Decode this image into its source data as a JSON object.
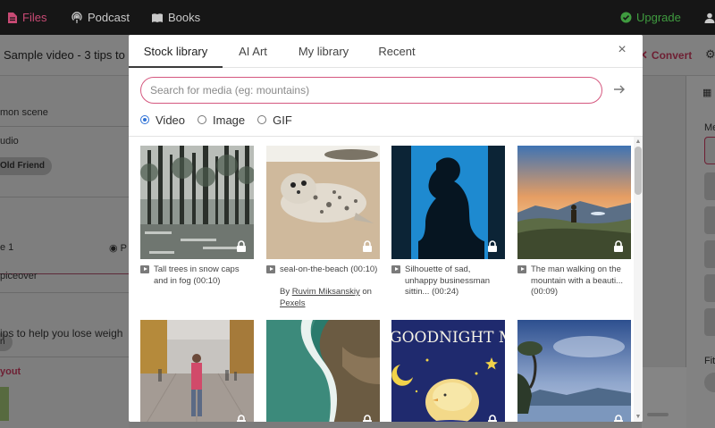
{
  "topnav": {
    "files": "Files",
    "podcast": "Podcast",
    "books": "Books",
    "upgrade": "Upgrade"
  },
  "editor": {
    "title": "Sample video - 3 tips to",
    "convert": "Convert",
    "left_rows": {
      "row1": "mon scene",
      "row2": "udio",
      "chip": "Old Friend",
      "scene": "e 1",
      "scene_right": "P",
      "voiceover": "piceover",
      "chip2": "n",
      "script": "ips to help you lose weigh",
      "layout": "yout"
    },
    "right_rows": {
      "me": "Me",
      "fit": "Fit"
    }
  },
  "modal": {
    "tabs": [
      "Stock library",
      "AI Art",
      "My library",
      "Recent"
    ],
    "active_tab": "Stock library",
    "close_icon": "close-icon",
    "search": {
      "placeholder": "Search for media (eg: mountains)",
      "value": ""
    },
    "media_types": [
      "Video",
      "Image",
      "GIF"
    ],
    "selected_media_type": "Video",
    "results": [
      {
        "caption": "Tall trees in snow caps and in fog (00:10)",
        "locked": true
      },
      {
        "caption": "seal-on-the-beach (00:10)",
        "credit_prefix": "By",
        "credit_author": "Ruvim Miksanskiy",
        "credit_mid": "on",
        "credit_source": "Pexels",
        "locked": true
      },
      {
        "caption": "Silhouette of sad, unhappy businessman sittin... (00:24)",
        "locked": true
      },
      {
        "caption": "The man walking on the mountain with a beauti... (00:09)",
        "locked": true
      },
      {
        "caption": "",
        "locked": true
      },
      {
        "caption": "",
        "locked": true
      },
      {
        "caption": "",
        "overlay_text": "GOODNIGHT MY LOV",
        "locked": true
      },
      {
        "caption": "",
        "locked": true
      }
    ]
  },
  "colors": {
    "accent": "#d5587f",
    "upgrade": "#3f9b3f",
    "radio": "#2f72d6"
  }
}
